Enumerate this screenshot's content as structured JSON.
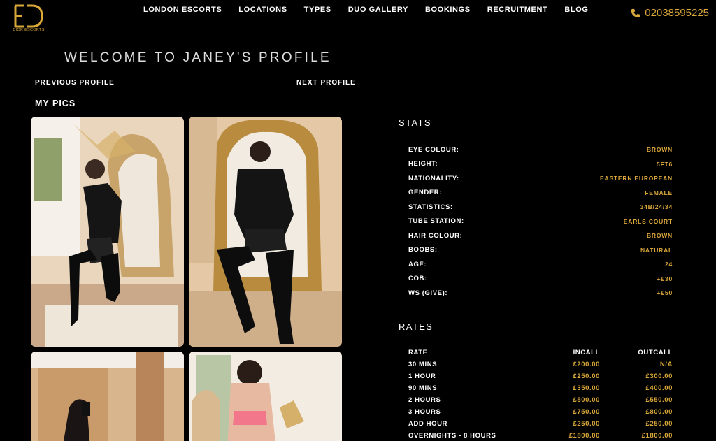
{
  "header": {
    "logo_text": "DIOR ESCORTS",
    "nav": [
      "LONDON ESCORTS",
      "LOCATIONS",
      "TYPES",
      "DUO GALLERY",
      "BOOKINGS",
      "RECRUITMENT",
      "BLOG"
    ],
    "phone": "02038595225",
    "phone_icon": "phone-icon"
  },
  "profile": {
    "welcome": "WELCOME TO JANEY'S PROFILE",
    "previous": "PREVIOUS PROFILE",
    "next": "NEXT PROFILE",
    "pics_title": "MY PICS"
  },
  "stats": {
    "title": "STATS",
    "rows": [
      {
        "label": "EYE COLOUR:",
        "value": "BROWN"
      },
      {
        "label": "HEIGHT:",
        "value": "5FT6"
      },
      {
        "label": "NATIONALITY:",
        "value": "EASTERN EUROPEAN"
      },
      {
        "label": "GENDER:",
        "value": "FEMALE"
      },
      {
        "label": "STATISTICS:",
        "value": "34B/24/34"
      },
      {
        "label": "TUBE STATION:",
        "value": "EARLS COURT"
      },
      {
        "label": "HAIR COLOUR:",
        "value": "BROWN"
      },
      {
        "label": "BOOBS:",
        "value": "NATURAL"
      },
      {
        "label": "AGE:",
        "value": "24"
      },
      {
        "label": "COB:",
        "value": "+£30"
      },
      {
        "label": "WS (GIVE):",
        "value": "+£50"
      }
    ]
  },
  "rates": {
    "title": "RATES",
    "header": {
      "label": "RATE",
      "incall": "INCALL",
      "outcall": "OUTCALL"
    },
    "rows": [
      {
        "label": "30 MINS",
        "incall": "£200.00",
        "outcall": "N/A"
      },
      {
        "label": "1 HOUR",
        "incall": "£250.00",
        "outcall": "£300.00"
      },
      {
        "label": "90 MINS",
        "incall": "£350.00",
        "outcall": "£400.00"
      },
      {
        "label": "2 HOURS",
        "incall": "£500.00",
        "outcall": "£550.00"
      },
      {
        "label": "3 HOURS",
        "incall": "£750.00",
        "outcall": "£800.00"
      },
      {
        "label": "ADD HOUR",
        "incall": "£250.00",
        "outcall": "£250.00"
      },
      {
        "label": "OVERNIGHTS - 8 HOURS",
        "incall": "£1800.00",
        "outcall": "£1800.00"
      }
    ]
  },
  "colors": {
    "accent": "#d9a73a",
    "background": "#000000"
  }
}
